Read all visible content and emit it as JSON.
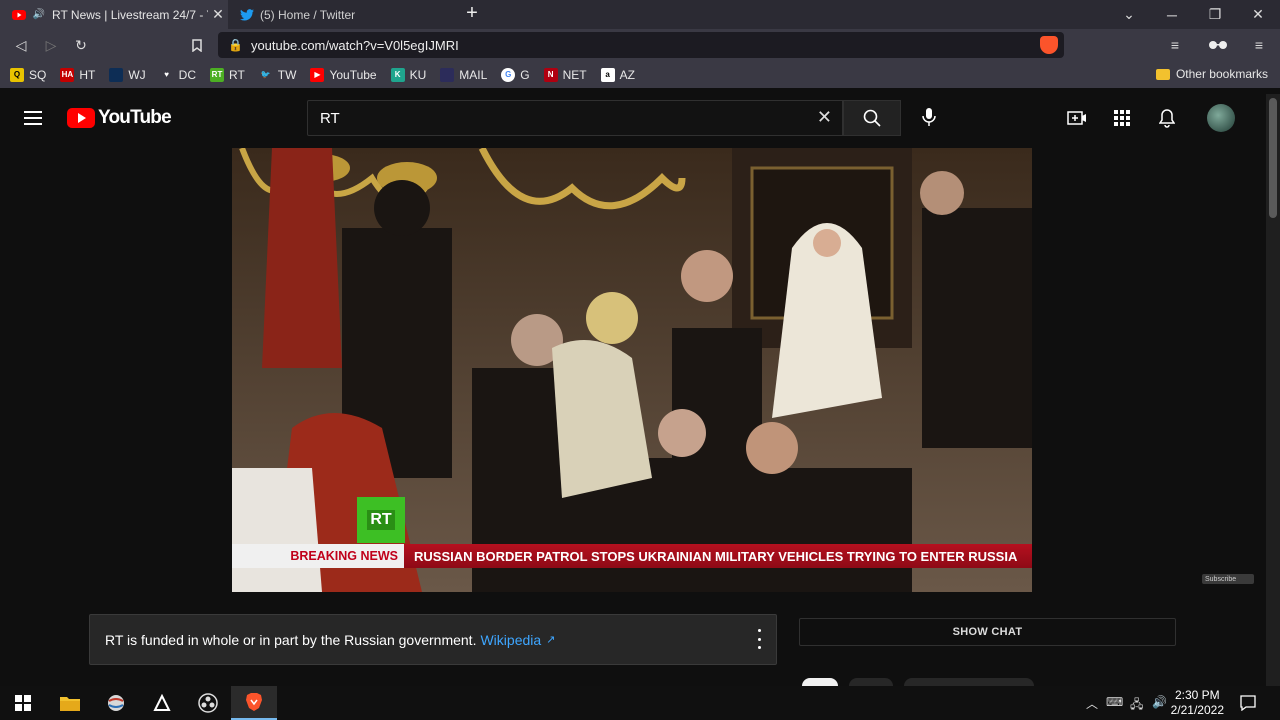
{
  "browser": {
    "tabs": [
      {
        "title": "RT News | Livestream 24/7 - Yo",
        "favicon": "youtube-favicon",
        "active": true
      },
      {
        "title": "(5) Home / Twitter",
        "favicon": "twitter-favicon",
        "active": false
      }
    ],
    "url": "youtube.com/watch?v=V0l5egIJMRI",
    "bookmarks": [
      {
        "label": "SQ",
        "icon": "Q",
        "color": "#e8c300"
      },
      {
        "label": "HT",
        "icon": "HA",
        "color": "#c40000"
      },
      {
        "label": "WJ",
        "icon": "",
        "color": "#0d2d55"
      },
      {
        "label": "DC",
        "icon": "♥",
        "color": "#3a3944"
      },
      {
        "label": "RT",
        "icon": "RT",
        "color": "#4caf23"
      },
      {
        "label": "TW",
        "icon": "🐦",
        "color": "#3a3944"
      },
      {
        "label": "YouTube",
        "icon": "▶",
        "color": "#ff0000"
      },
      {
        "label": "KU",
        "icon": "K",
        "color": "#1fa58e"
      },
      {
        "label": "MAIL",
        "icon": "",
        "color": "#2c2c5a"
      },
      {
        "label": "G",
        "icon": "G",
        "color": "#ffffff"
      },
      {
        "label": "NET",
        "icon": "N",
        "color": "#b00010"
      },
      {
        "label": "AZ",
        "icon": "a",
        "color": "#ffffff"
      }
    ],
    "other_bookmarks": "Other bookmarks"
  },
  "youtube": {
    "logo_text": "YouTube",
    "search_value": "RT",
    "video": {
      "breaking_label": "BREAKING NEWS",
      "headline": "RUSSIAN BORDER PATROL STOPS UKRAINIAN MILITARY VEHICLES TRYING TO ENTER RUSSIA",
      "channel_bug": "RT",
      "subscribe_tag": "Subscribe"
    },
    "info_panel": {
      "text": "RT is funded in whole or in part by the Russian government.",
      "link": "Wikipedia"
    },
    "show_chat": "SHOW CHAT"
  },
  "taskbar": {
    "time": "2:30 PM",
    "date": "2/21/2022"
  }
}
